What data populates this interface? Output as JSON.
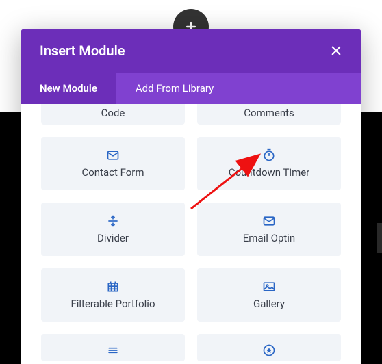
{
  "header": {
    "title": "Insert Module"
  },
  "tabs": {
    "new_module": "New Module",
    "add_from_library": "Add From Library"
  },
  "modules": {
    "code": "Code",
    "comments": "Comments",
    "contact_form": "Contact Form",
    "countdown_timer": "Countdown Timer",
    "divider": "Divider",
    "email_optin": "Email Optin",
    "filterable_portfolio": "Filterable Portfolio",
    "gallery": "Gallery"
  }
}
